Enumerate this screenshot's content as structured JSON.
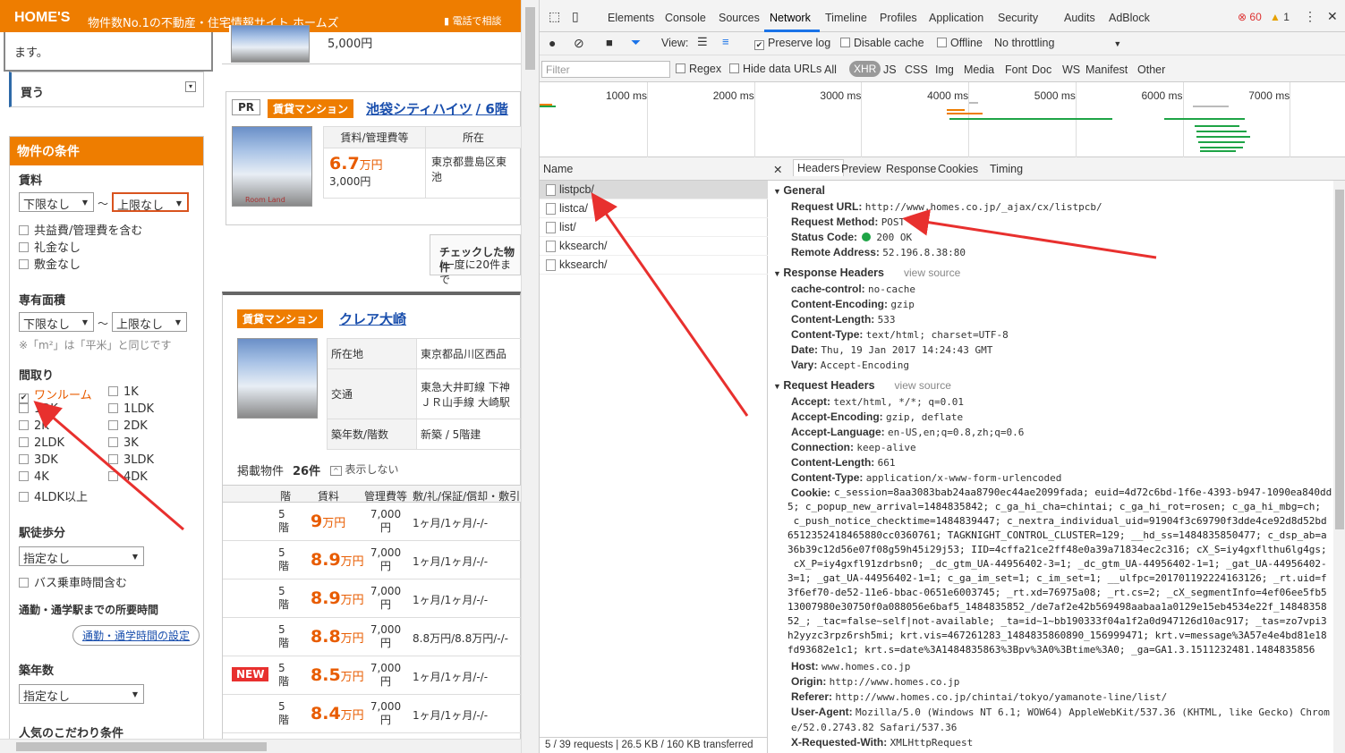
{
  "site": {
    "logo": "HOME'S",
    "tagline": "物件数No.1の不動産・住宅情報サイト ホームズ",
    "phone_btn": "電話で相談"
  },
  "popup": {
    "text": "ます。"
  },
  "sidebar": {
    "buy": "買う",
    "cond_title": "物件の条件",
    "rent_label": "賃料",
    "rent_min": "下限なし",
    "rent_max": "上限なし",
    "tilde": "〜",
    "rent_opts": [
      "共益費/管理費を含む",
      "礼金なし",
      "敷金なし"
    ],
    "area_label": "専有面積",
    "area_min": "下限なし",
    "area_max": "上限なし",
    "area_note": "※「m²」は「平米」と同じです",
    "layout_label": "間取り",
    "layouts_left": [
      "ワンルーム",
      "1DK",
      "2K",
      "2LDK",
      "3DK",
      "4K",
      "4LDK以上"
    ],
    "layouts_right": [
      "1K",
      "1LDK",
      "2DK",
      "3K",
      "3LDK",
      "4DK"
    ],
    "walk_label": "駅徒歩分",
    "walk_val": "指定なし",
    "bus": "バス乗車時間含む",
    "commute_label": "通勤・通学駅までの所要時間",
    "commute_btn": "通勤・通学時間の設定",
    "age_label": "築年数",
    "age_val": "指定なし",
    "pop_label": "人気のこだわり条件"
  },
  "listing0": {
    "price_small": "5,000円"
  },
  "listing1": {
    "pr": "PR",
    "type": "賃貸マンション",
    "name": "池袋シティハイツ",
    "floor": "/ 6階",
    "col1": "賃料/管理費等",
    "col2": "所在",
    "price": "6.7",
    "unit": "万円",
    "fee": "3,000円",
    "addr": "東京都豊島区東池",
    "img_caption": "Room Land"
  },
  "checkbox_banner": {
    "line1": "チェックした物件",
    "line2": "(一度に20件まで"
  },
  "listing2": {
    "type": "賃貸マンション",
    "name": "クレア大崎",
    "loc_label": "所在地",
    "loc": "東京都品川区西品",
    "traffic_label": "交通",
    "traffic1": "東急大井町線 下神",
    "traffic2": "ＪＲ山手線 大崎駅",
    "age_label": "築年数/階数",
    "age": "新築 / 5階建",
    "count_label": "掲載物件",
    "count": "26件",
    "hide": "表示しない",
    "cols": [
      "階",
      "賃料",
      "管理費等",
      "敷/礼/保証/償却・敷引"
    ],
    "rows": [
      {
        "new": "",
        "floor": "5階",
        "price": "9",
        "fee": "7,000円",
        "terms": "1ヶ月/1ヶ月/-/-"
      },
      {
        "new": "",
        "floor": "5階",
        "price": "8.9",
        "fee": "7,000円",
        "terms": "1ヶ月/1ヶ月/-/-"
      },
      {
        "new": "",
        "floor": "5階",
        "price": "8.9",
        "fee": "7,000円",
        "terms": "1ヶ月/1ヶ月/-/-"
      },
      {
        "new": "",
        "floor": "5階",
        "price": "8.8",
        "fee": "7,000円",
        "terms": "8.8万円/8.8万円/-/-"
      },
      {
        "new": "NEW",
        "floor": "5階",
        "price": "8.5",
        "fee": "7,000円",
        "terms": "1ヶ月/1ヶ月/-/-"
      },
      {
        "new": "",
        "floor": "5階",
        "price": "8.4",
        "fee": "7,000円",
        "terms": "1ヶ月/1ヶ月/-/-"
      }
    ],
    "unit": "万円"
  },
  "devtools": {
    "tabs": [
      "Elements",
      "Console",
      "Sources",
      "Network",
      "Timeline",
      "Profiles",
      "Application",
      "Security",
      "Audits",
      "AdBlock"
    ],
    "errors": "60",
    "warnings": "1",
    "view": "View:",
    "preserve": "Preserve log",
    "disable_cache": "Disable cache",
    "offline": "Offline",
    "throttle": "No throttling",
    "filter_placeholder": "Filter",
    "regex": "Regex",
    "hide_data": "Hide data URLs",
    "types": [
      "All",
      "XHR",
      "JS",
      "CSS",
      "Img",
      "Media",
      "Font",
      "Doc",
      "WS",
      "Manifest",
      "Other"
    ],
    "ticks": [
      "1000 ms",
      "2000 ms",
      "3000 ms",
      "4000 ms",
      "5000 ms",
      "6000 ms",
      "7000 ms"
    ],
    "name_hdr": "Name",
    "requests": [
      "listpcb/",
      "listca/",
      "list/",
      "kksearch/",
      "kksearch/"
    ],
    "status": "5 / 39 requests  |  26.5 KB / 160 KB transferred",
    "detail_tabs": [
      "Headers",
      "Preview",
      "Response",
      "Cookies",
      "Timing"
    ],
    "general": "General",
    "general_kv": [
      [
        "Request URL:",
        "http://www.homes.co.jp/_ajax/cx/listpcb/"
      ],
      [
        "Request Method:",
        "POST"
      ],
      [
        "Status Code:",
        "200 OK"
      ],
      [
        "Remote Address:",
        "52.196.8.38:80"
      ]
    ],
    "resp_hdr": "Response Headers",
    "view_source": "view source",
    "resp_kv": [
      [
        "cache-control:",
        "no-cache"
      ],
      [
        "Content-Encoding:",
        "gzip"
      ],
      [
        "Content-Length:",
        "533"
      ],
      [
        "Content-Type:",
        "text/html; charset=UTF-8"
      ],
      [
        "Date:",
        "Thu, 19 Jan 2017 14:24:43 GMT"
      ],
      [
        "Vary:",
        "Accept-Encoding"
      ]
    ],
    "req_hdr": "Request Headers",
    "req_kv": [
      [
        "Accept:",
        "text/html, */*; q=0.01"
      ],
      [
        "Accept-Encoding:",
        "gzip, deflate"
      ],
      [
        "Accept-Language:",
        "en-US,en;q=0.8,zh;q=0.6"
      ],
      [
        "Connection:",
        "keep-alive"
      ],
      [
        "Content-Length:",
        "661"
      ],
      [
        "Content-Type:",
        "application/x-www-form-urlencoded"
      ]
    ],
    "cookie_label": "Cookie:",
    "cookie_lines": [
      "c_session=8aa3083bab24aa8790ec44ae2099fada; euid=4d72c6bd-1f6e-4393-b947-1090ea840dd",
      "5; c_popup_new_arrival=1484835842; c_ga_hi_cha=chintai; c_ga_hi_rot=rosen; c_ga_hi_mbg=ch;",
      " c_push_notice_checktime=1484839447; c_nextra_individual_uid=91904f3c69790f3dde4ce92d8d52bd",
      "6512352418465880cc0360761; TAGKNIGHT_CONTROL_CLUSTER=129; __hd_ss=1484835850477; c_dsp_ab=a",
      "36b39c12d56e07f08g59h45i29j53; IID=4cffa21ce2ff48e0a39a71834ec2c316; cX_S=iy4gxflthu6lg4gs;",
      " cX_P=iy4gxfl91zdrbsn0; _dc_gtm_UA-44956402-3=1; _dc_gtm_UA-44956402-1=1; _gat_UA-44956402-",
      "3=1; _gat_UA-44956402-1=1; c_ga_im_set=1; c_im_set=1; __ulfpc=201701192224163126; _rt.uid=f",
      "3f6ef70-de52-11e6-bbac-0651e6003745; _rt.xd=76975a08; _rt.cs=2; _cX_segmentInfo=4ef06ee5fb5",
      "13007980e30750f0a088056e6baf5_1484835852_/de7af2e42b569498aabaa1a0129e15eb4534e22f_14848358",
      "52_; _tac=false~self|not-available; _ta=id~1~bb190333f04a1f2a0d947126d10ac917; _tas=zo7vpi3",
      "h2yyzc3rpz6rsh5mi; krt.vis=467261283_1484835860890_156999471; krt.v=message%3A57e4e4bd81e18",
      "fd93682e1c1; krt.s=date%3A1484835863%3Bpv%3A0%3Btime%3A0; _ga=GA1.3.1511232481.1484835856"
    ],
    "tail_kv": [
      [
        "Host:",
        "www.homes.co.jp"
      ],
      [
        "Origin:",
        "http://www.homes.co.jp"
      ],
      [
        "Referer:",
        "http://www.homes.co.jp/chintai/tokyo/yamanote-line/list/"
      ],
      [
        "User-Agent:",
        "Mozilla/5.0 (Windows NT 6.1; WOW64) AppleWebKit/537.36 (KHTML, like Gecko) Chrom"
      ],
      [
        "",
        "e/52.0.2743.82 Safari/537.36"
      ],
      [
        "X-Requested-With:",
        "XMLHttpRequest"
      ]
    ]
  },
  "colors": {
    "accent": "#ee7d00",
    "link": "#1a4fad",
    "price": "#e85c00",
    "arrow": "#e8302e",
    "status_ok": "#1ea446"
  }
}
